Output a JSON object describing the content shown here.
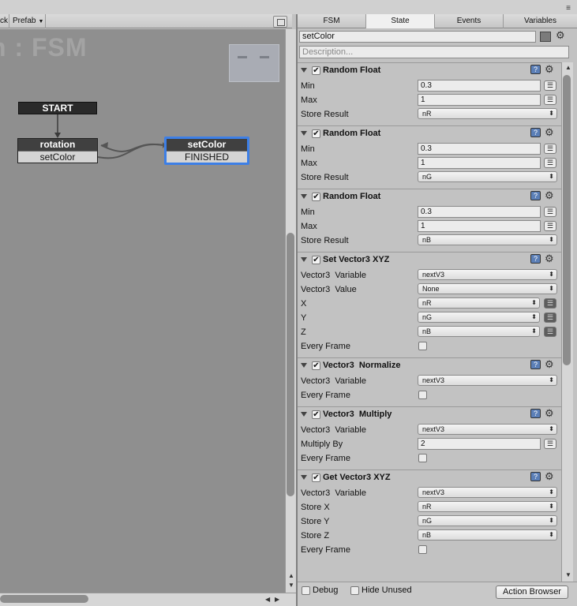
{
  "toolbar": {
    "left_cut": "ck",
    "prefab_label": "Prefab",
    "prefab_arrow": "▼"
  },
  "menu_icon": "≡",
  "canvas": {
    "title": "n : FSM"
  },
  "nodes": {
    "start": "START",
    "rotation": {
      "title": "rotation",
      "transition": "setColor"
    },
    "setcolor": {
      "title": "setColor",
      "transition": "FINISHED"
    }
  },
  "tabs": [
    "FSM",
    "State",
    "Events",
    "Variables"
  ],
  "active_tab": "State",
  "state": {
    "name": "setColor",
    "description_placeholder": "Description..."
  },
  "actions": [
    {
      "title": "Random Float",
      "rows": [
        {
          "label": "Min",
          "kind": "field",
          "value": "0.3"
        },
        {
          "label": "Max",
          "kind": "field",
          "value": "1"
        },
        {
          "label": "Store Result",
          "kind": "dropdown",
          "value": "nR"
        }
      ]
    },
    {
      "title": "Random Float",
      "rows": [
        {
          "label": "Min",
          "kind": "field",
          "value": "0.3"
        },
        {
          "label": "Max",
          "kind": "field",
          "value": "1"
        },
        {
          "label": "Store Result",
          "kind": "dropdown",
          "value": "nG"
        }
      ]
    },
    {
      "title": "Random Float",
      "rows": [
        {
          "label": "Min",
          "kind": "field",
          "value": "0.3"
        },
        {
          "label": "Max",
          "kind": "field",
          "value": "1"
        },
        {
          "label": "Store Result",
          "kind": "dropdown",
          "value": "nB"
        }
      ]
    },
    {
      "title": "Set Vector3 XYZ",
      "rows": [
        {
          "label": "Vector3  Variable",
          "kind": "dropdown",
          "value": "nextV3"
        },
        {
          "label": "Vector3  Value",
          "kind": "dropdown",
          "value": "None"
        },
        {
          "label": "X",
          "kind": "dropdown-eq",
          "value": "nR"
        },
        {
          "label": "Y",
          "kind": "dropdown-eq",
          "value": "nG"
        },
        {
          "label": "Z",
          "kind": "dropdown-eq",
          "value": "nB"
        },
        {
          "label": "Every Frame",
          "kind": "checkbox"
        }
      ]
    },
    {
      "title": "Vector3  Normalize",
      "rows": [
        {
          "label": "Vector3  Variable",
          "kind": "dropdown",
          "value": "nextV3"
        },
        {
          "label": "Every Frame",
          "kind": "checkbox"
        }
      ]
    },
    {
      "title": "Vector3  Multiply",
      "rows": [
        {
          "label": "Vector3  Variable",
          "kind": "dropdown",
          "value": "nextV3"
        },
        {
          "label": "Multiply By",
          "kind": "field",
          "value": "2"
        },
        {
          "label": "Every Frame",
          "kind": "checkbox"
        }
      ]
    },
    {
      "title": "Get Vector3 XYZ",
      "rows": [
        {
          "label": "Vector3  Variable",
          "kind": "dropdown",
          "value": "nextV3"
        },
        {
          "label": "Store X",
          "kind": "dropdown",
          "value": "nR"
        },
        {
          "label": "Store Y",
          "kind": "dropdown",
          "value": "nG"
        },
        {
          "label": "Store Z",
          "kind": "dropdown",
          "value": "nB"
        },
        {
          "label": "Every Frame",
          "kind": "checkbox"
        }
      ]
    }
  ],
  "bottom": {
    "debug": "Debug",
    "hide_unused": "Hide Unused",
    "action_browser": "Action Browser"
  },
  "icons": {
    "help": "help-icon",
    "settings": "gear-icon",
    "checkbox": "checkmark-icon",
    "collapse": "triangle-down-icon"
  },
  "colors": {
    "selection": "#3d7fe6",
    "node_header": "#404040",
    "state_color": "#7b7b7b"
  }
}
